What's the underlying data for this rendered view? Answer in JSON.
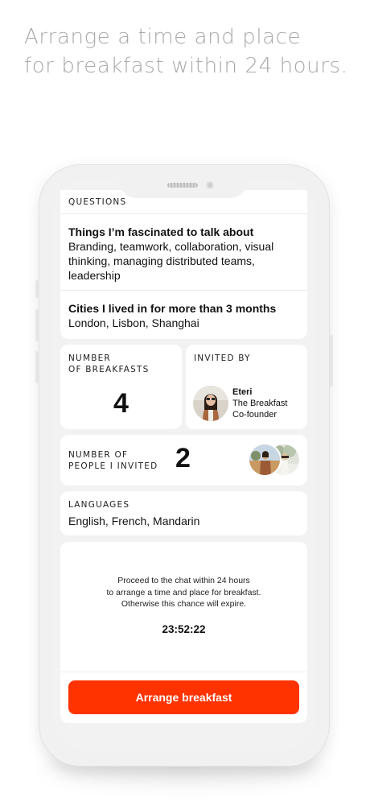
{
  "headline": {
    "line1": "Arrange a time and place",
    "line2": "for breakfast within 24 hours."
  },
  "questions": {
    "section_label": "QUESTIONS",
    "items": [
      {
        "title": "Things I’m fascinated to talk about",
        "lines": [
          "Branding, teamwork, collaboration, visual",
          "thinking, managing distributed teams,",
          "leadership"
        ]
      },
      {
        "title": "Cities I lived in for more than 3 months",
        "lines": [
          "London, Lisbon, Shanghai"
        ]
      }
    ]
  },
  "breakfasts": {
    "label_line1": "NUMBER",
    "label_line2": "OF BREAKFASTS",
    "value": "4"
  },
  "invited_by": {
    "label": "INVITED BY",
    "name": "Eteri",
    "role_line1": "The Breakfast",
    "role_line2": "Co-founder"
  },
  "people_invited": {
    "label_line1": "NUMBER OF",
    "label_line2": "PEOPLE I INVITED",
    "value": "2"
  },
  "languages": {
    "label": "LANGUAGES",
    "value": "English, French, Mandarin"
  },
  "proceed": {
    "line1": "Proceed to the chat within 24 hours",
    "line2": "to arrange a time and place for breakfast.",
    "line3": "Otherwise this chance will expire.",
    "timer": "23:52:22"
  },
  "cta": {
    "label": "Arrange breakfast"
  },
  "colors": {
    "accent": "#ff3300",
    "headline": "#a9a9a9",
    "card": "#ffffff",
    "screen_bg": "#f2f2f2"
  }
}
